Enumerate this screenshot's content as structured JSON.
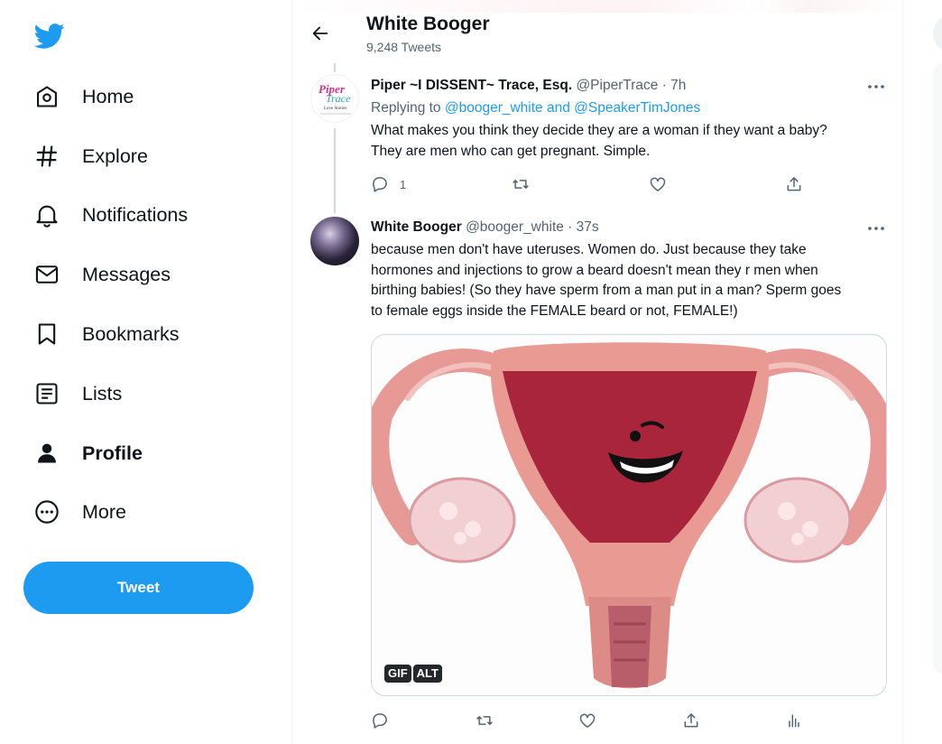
{
  "nav": {
    "logo": "twitter-bird-icon",
    "items": [
      {
        "label": "Home",
        "icon": "home-icon"
      },
      {
        "label": "Explore",
        "icon": "hashtag-icon"
      },
      {
        "label": "Notifications",
        "icon": "bell-icon"
      },
      {
        "label": "Messages",
        "icon": "envelope-icon"
      },
      {
        "label": "Bookmarks",
        "icon": "bookmark-icon"
      },
      {
        "label": "Lists",
        "icon": "list-icon"
      },
      {
        "label": "Profile",
        "icon": "person-icon",
        "active": true
      },
      {
        "label": "More",
        "icon": "more-circle-icon"
      }
    ],
    "tweet_button": "Tweet"
  },
  "header": {
    "title": "White Booger",
    "subtitle": "9,248 Tweets"
  },
  "tweets": [
    {
      "name": "Piper ~I DISSENT~ Trace, Esq.",
      "handle": "@PiperTrace",
      "time": "· 7h",
      "replying_prefix": "Replying to",
      "replying_mentions": "@booger_white and @SpeakerTimJones",
      "text_lines": [
        "What makes you think they decide they are a woman if they want a baby?",
        "They are men who can get pregnant. Simple."
      ],
      "reply_count": "1",
      "avatar_text": {
        "line1": "Piper",
        "line2": "Trace",
        "line3": "Love Stories"
      }
    },
    {
      "name": "White Booger",
      "handle": "@booger_white",
      "time": "· 37s",
      "text_lines": [
        "because men don't have uteruses. Women do. Just because they take",
        "hormones and injections to grow a beard doesn't mean they r men when",
        "birthing babies! (So they have sperm from a man put in a man? Sperm goes",
        "to female eggs inside the FEMALE beard or not, FEMALE!)"
      ],
      "media_badges": [
        "GIF",
        "ALT"
      ]
    }
  ],
  "colors": {
    "accent": "#1d9bf0",
    "text": "#0f1419",
    "secondary": "#536471"
  }
}
